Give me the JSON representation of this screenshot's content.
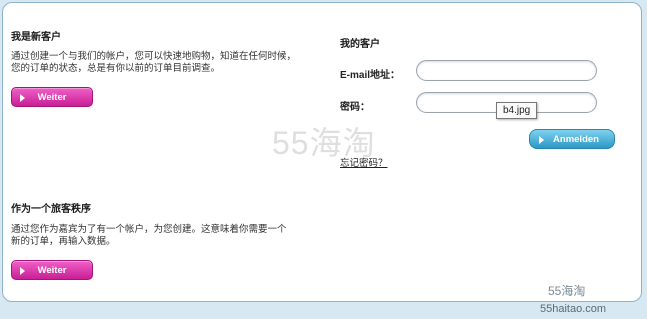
{
  "new_customer": {
    "heading": "我是新客户",
    "text_line1": "通过创建一个与我们的帐户，您可以快速地购物，知道在任何时候，",
    "text_line2": "您的订单的状态，总是有你以前的订单目前调查。",
    "button_label": "Weiter"
  },
  "guest": {
    "heading": "作为一个旅客秩序",
    "text_line1": "通过您作为嘉宾为了有一个帐户，为您创建。这意味着你需要一个",
    "text_line2": "新的订单，再输入数据。",
    "button_label": "Weiter"
  },
  "login": {
    "heading": "我的客户",
    "email_label": "E-mail地址：",
    "email_value": "",
    "password_label": "密码：",
    "password_value": "",
    "button_label": "Anmelden",
    "forgot_link": "忘记密码？"
  },
  "tooltip": "b4.jpg",
  "watermarks": {
    "big": "55海淘",
    "small": "55海淘",
    "url": "55haitao.com"
  },
  "colors": {
    "accent_pink": "#d42aa3",
    "accent_blue": "#3fa8d4"
  }
}
